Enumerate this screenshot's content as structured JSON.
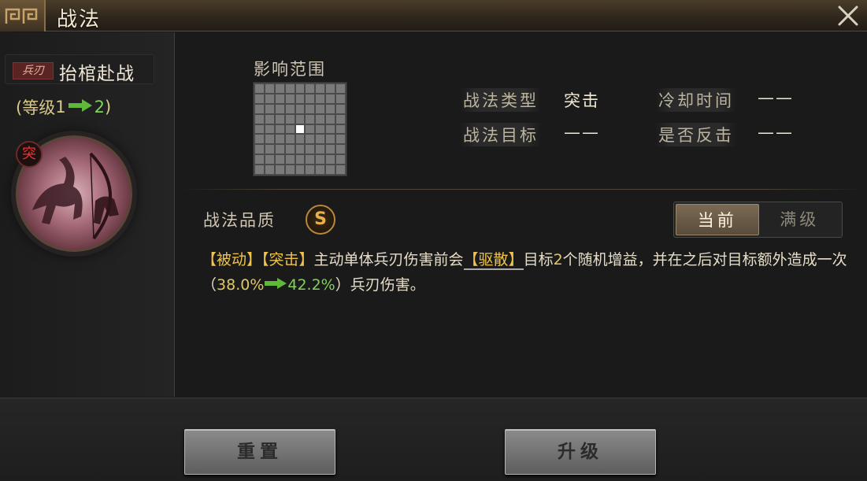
{
  "window": {
    "title": "战法"
  },
  "skill": {
    "type_tag": "兵刃",
    "name": "抬棺赴战",
    "level_open": "(等级",
    "level_from": "1",
    "level_to": "2",
    "level_close": ")",
    "badge": "突"
  },
  "range": {
    "label": "影响范围",
    "grid_size": 9,
    "active_cells": [
      [
        4,
        4
      ]
    ]
  },
  "info": {
    "type_label": "战法类型",
    "type_value": "突击",
    "cooldown_label": "冷却时间",
    "cooldown_value": "——",
    "target_label": "战法目标",
    "target_value": "——",
    "counter_label": "是否反击",
    "counter_value": "——"
  },
  "quality": {
    "label": "战法品质",
    "grade": "S"
  },
  "tabs": {
    "current": "当前",
    "max": "满级"
  },
  "description": {
    "tag1": "【被动】",
    "tag2": "【突击】",
    "part1": "主动单体兵刃伤害前会",
    "tag3": "【驱散】",
    "part2": "目标",
    "count": "2",
    "part3": "个随机增益，并在之后对目标额外造成一次（",
    "pct_from": "38.0%",
    "pct_to": "42.2%",
    "part4": "）兵刃伤害。"
  },
  "buttons": {
    "reset": "重置",
    "upgrade": "升级"
  },
  "colors": {
    "accent_gold": "#f0c44a",
    "upgrade_green": "#7fd35a",
    "tag_red": "#5a2424"
  }
}
